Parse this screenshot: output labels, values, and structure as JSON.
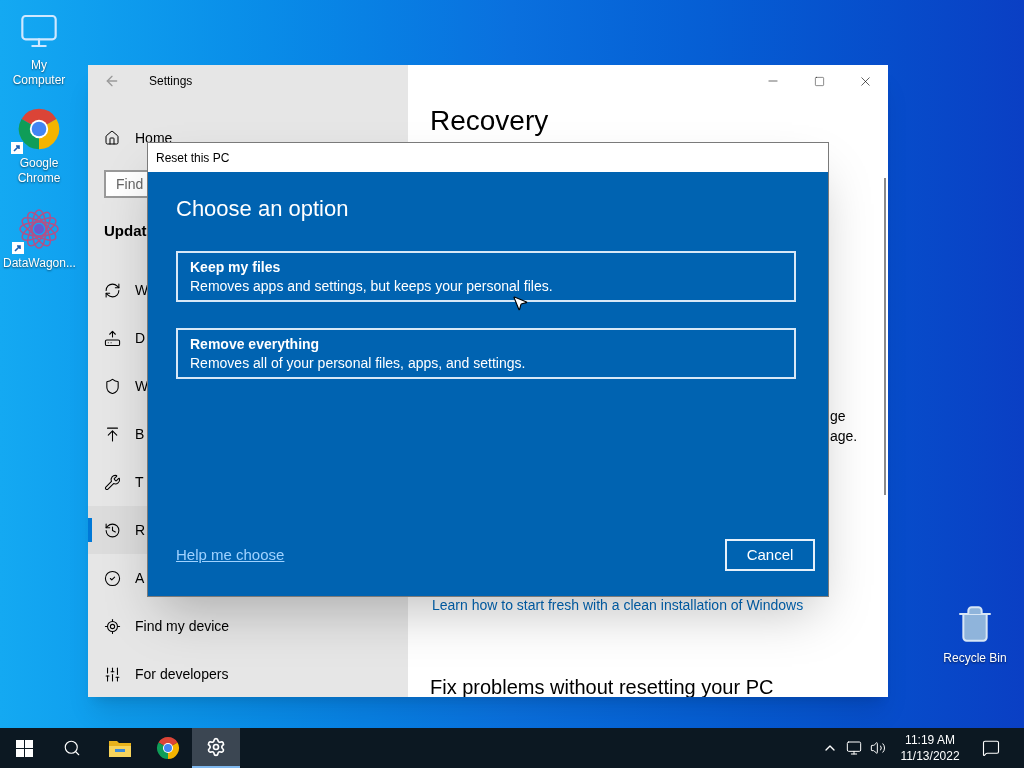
{
  "desktop_icons": [
    {
      "kind": "computer",
      "label": "My Computer"
    },
    {
      "kind": "chrome",
      "label": "Google Chrome"
    },
    {
      "kind": "datawagon",
      "label": "DataWagon..."
    },
    {
      "kind": "recycle_bin",
      "label": "Recycle Bin"
    }
  ],
  "settings": {
    "title": "Settings",
    "home": "Home",
    "search": {
      "placeholder": "Find"
    },
    "section": "Updat",
    "items": [
      {
        "label": "W",
        "selected": false
      },
      {
        "label": "D",
        "selected": false
      },
      {
        "label": "W",
        "selected": false
      },
      {
        "label": "B",
        "selected": false
      },
      {
        "label": "T",
        "selected": false
      },
      {
        "label": "R",
        "selected": true
      },
      {
        "label": "A",
        "selected": false
      },
      {
        "label": "Find my device",
        "selected": false
      },
      {
        "label": "For developers",
        "selected": false
      }
    ],
    "content": {
      "heading": "Recovery",
      "text_fragments": [
        "ge",
        "age."
      ],
      "link": "Learn how to start fresh with a clean installation of Windows",
      "subheading": "Fix problems without resetting your PC"
    }
  },
  "dialog": {
    "title": "Reset this PC",
    "heading": "Choose an option",
    "options": [
      {
        "title": "Keep my files",
        "description": "Removes apps and settings, but keeps your personal files."
      },
      {
        "title": "Remove everything",
        "description": "Removes all of your personal files, apps, and settings."
      }
    ],
    "help_link": "Help me choose",
    "cancel": "Cancel"
  },
  "taskbar": {
    "apps": [
      {
        "kind": "start",
        "selected": false
      },
      {
        "kind": "search",
        "selected": false
      },
      {
        "kind": "explorer",
        "selected": false
      },
      {
        "kind": "chrome",
        "selected": false
      },
      {
        "kind": "settings",
        "selected": true
      }
    ],
    "time": "11:19 AM",
    "date": "11/13/2022"
  }
}
